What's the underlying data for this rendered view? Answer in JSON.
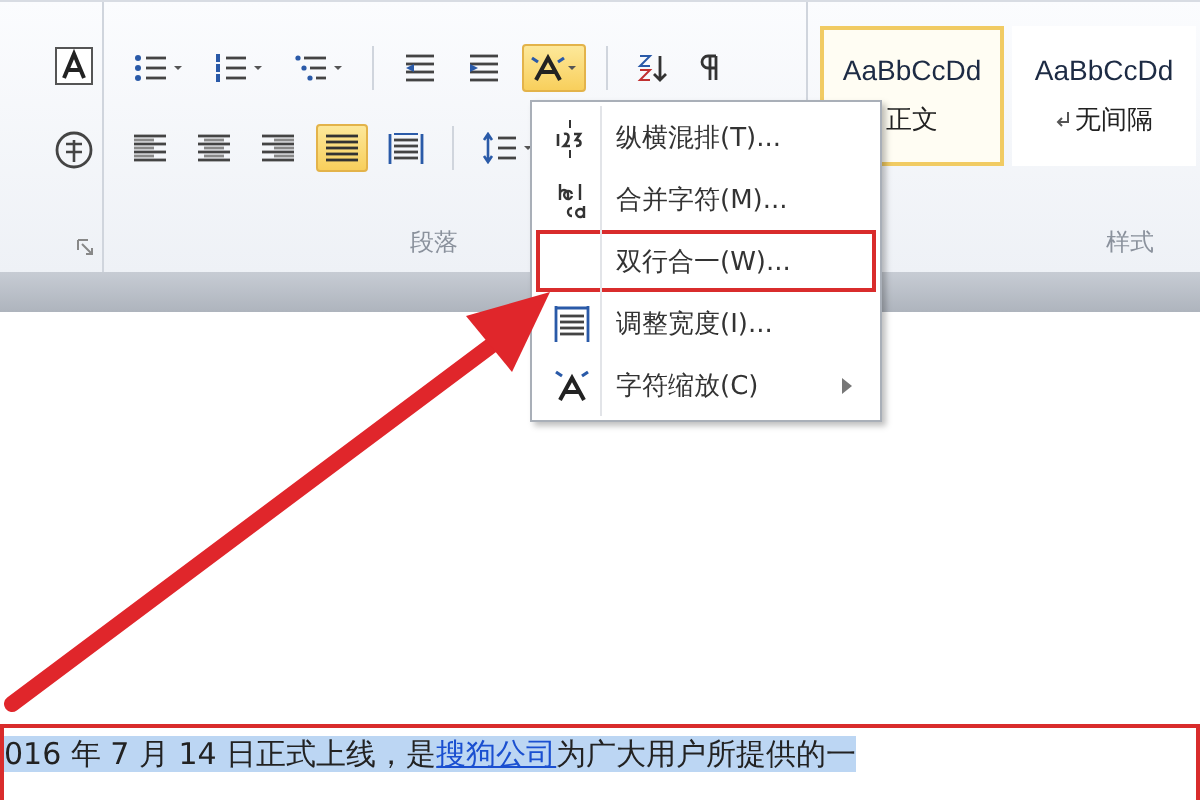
{
  "ribbon": {
    "paragraph_group": {
      "label": "段落",
      "row1": [
        {
          "selected": false
        },
        {
          "selected": false
        },
        {
          "selected": false
        },
        {
          "selected": false
        },
        {
          "selected": false
        },
        {
          "selected": true
        },
        {
          "selected": false
        },
        {
          "selected": false
        }
      ],
      "row2": [
        {
          "selected": false
        },
        {
          "selected": false
        },
        {
          "selected": false
        },
        {
          "selected": true
        },
        {
          "selected": false
        },
        {
          "selected": false
        }
      ]
    },
    "styles_group": {
      "label": "样式",
      "styles": [
        {
          "preview": "AaBbCcDd",
          "name": "正文",
          "selected": true
        },
        {
          "preview": "AaBbCcDd",
          "name": "无间隔",
          "selected": false
        }
      ]
    }
  },
  "menu": {
    "items": [
      {
        "label": "纵横混排(T)...",
        "annotated": false,
        "has_submenu": false
      },
      {
        "label": "合并字符(M)...",
        "annotated": false,
        "has_submenu": false
      },
      {
        "label": "双行合一(W)...",
        "annotated": true,
        "has_submenu": false
      },
      {
        "label": "调整宽度(I)...",
        "annotated": false,
        "has_submenu": false
      },
      {
        "label": "字符缩放(C)",
        "annotated": false,
        "has_submenu": true
      }
    ]
  },
  "document": {
    "paragraph": {
      "before": "016 年 7 月 14 日正式上线，是",
      "link": "搜狗公司",
      "after": "为广大用户所提供的一",
      "selected": true,
      "annotated": true
    }
  }
}
